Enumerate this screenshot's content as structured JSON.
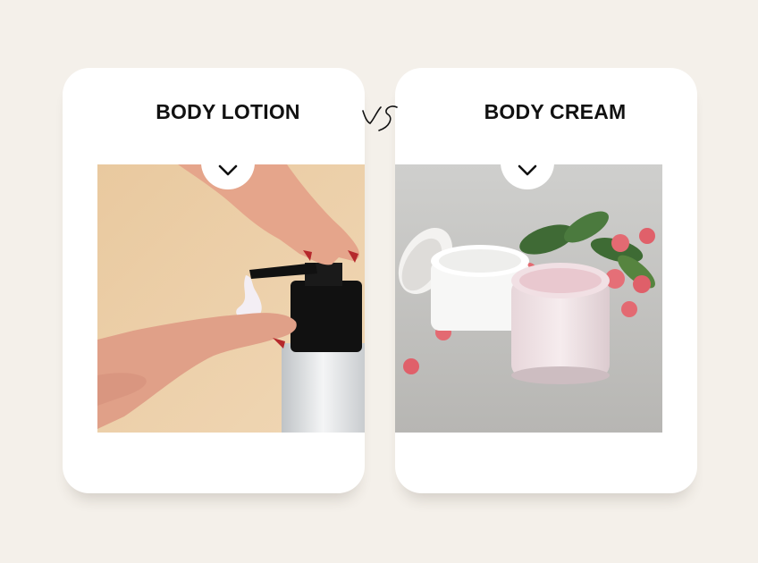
{
  "cards": [
    {
      "title": "BODY LOTION",
      "image": "lotion-pump-dispensing-photo"
    },
    {
      "title": "BODY CREAM",
      "image": "cream-jars-with-flowers-photo"
    }
  ],
  "separator": "vs",
  "icons": {
    "toggle": "chevron-down-icon"
  },
  "colors": {
    "background": "#f4f0ea",
    "card": "#ffffff",
    "text": "#111111"
  }
}
